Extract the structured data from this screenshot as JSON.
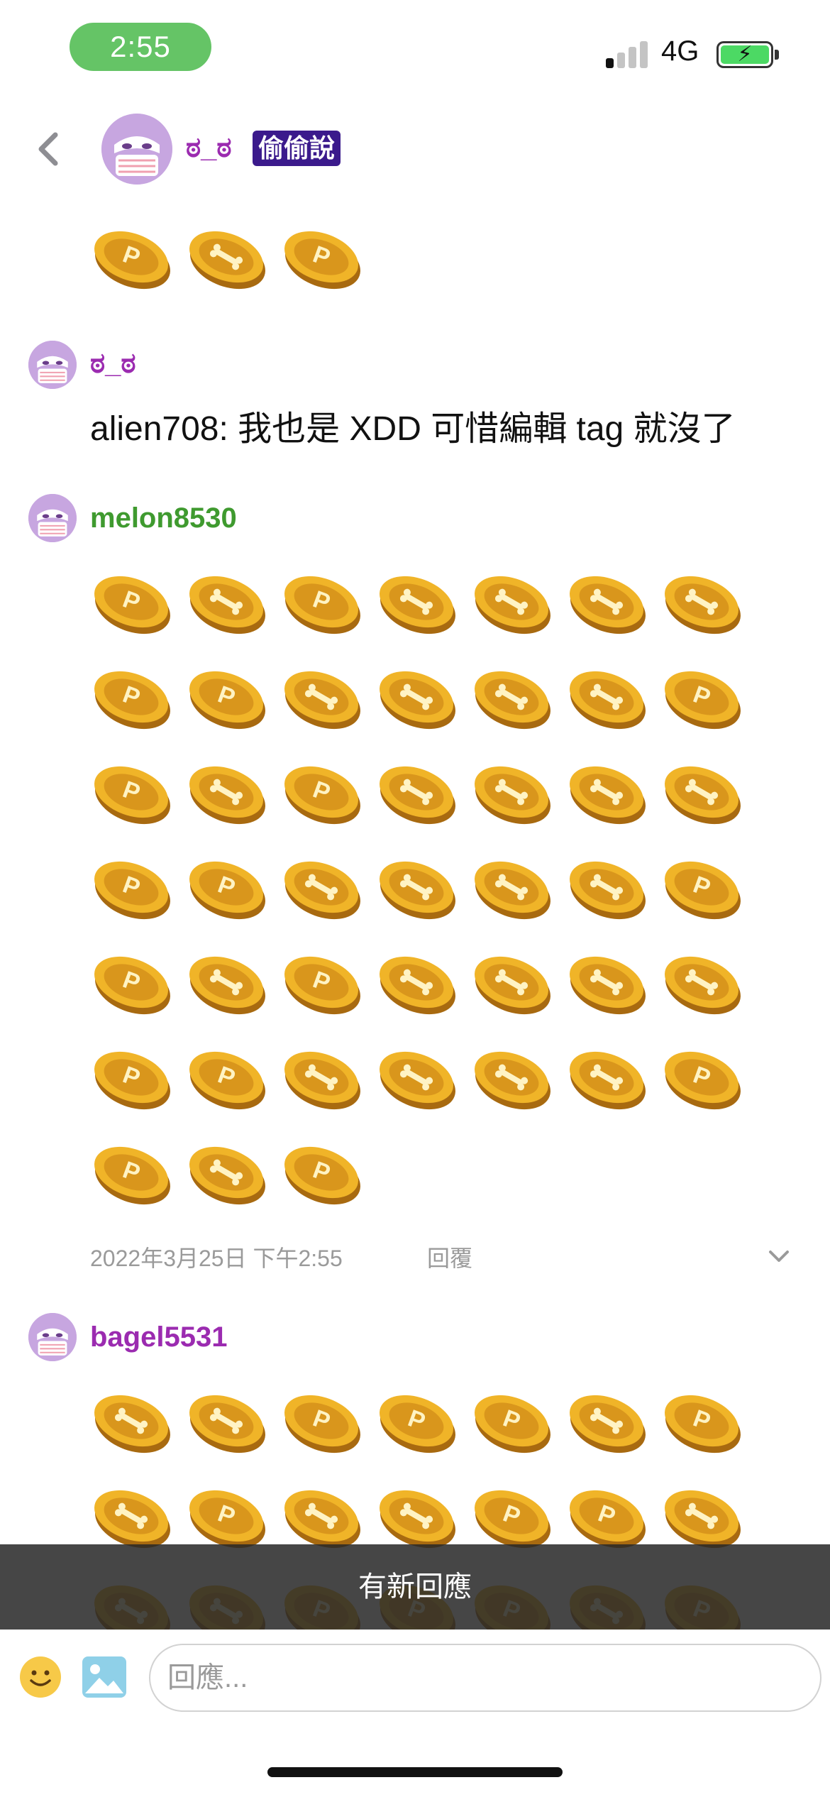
{
  "status_bar": {
    "time": "2:55",
    "network": "4G",
    "signal_bars_on": 1,
    "signal_bars_total": 4,
    "battery_charging": true,
    "battery_color": "#4cd964",
    "time_pill_color": "#65c466"
  },
  "header": {
    "back_icon": "chevron-left-icon",
    "name": "ಠ_ಠ",
    "badge": "偷偷說",
    "name_color": "#9b2bb0",
    "badge_color": "#3b1a8c"
  },
  "comments": [
    {
      "user": "ಠ_ಠ",
      "user_color": "#9b2bb0",
      "text": "alien708: 我也是 XDD 可惜編輯 tag 就沒了"
    },
    {
      "user": "melon8530",
      "user_color": "#3f9a2f",
      "coin_count": 45,
      "timestamp": "2022年3月25日 下午2:55",
      "reply_label": "回覆"
    },
    {
      "user": "bagel5531",
      "user_color": "#9b2bb0"
    }
  ],
  "banner": {
    "text": "有新回應"
  },
  "input": {
    "placeholder": "回應...",
    "value": ""
  },
  "icons": {
    "coin_p": "coin-p-icon",
    "coin_bone": "coin-bone-icon",
    "emoji": "smiley-icon",
    "image": "image-icon"
  }
}
